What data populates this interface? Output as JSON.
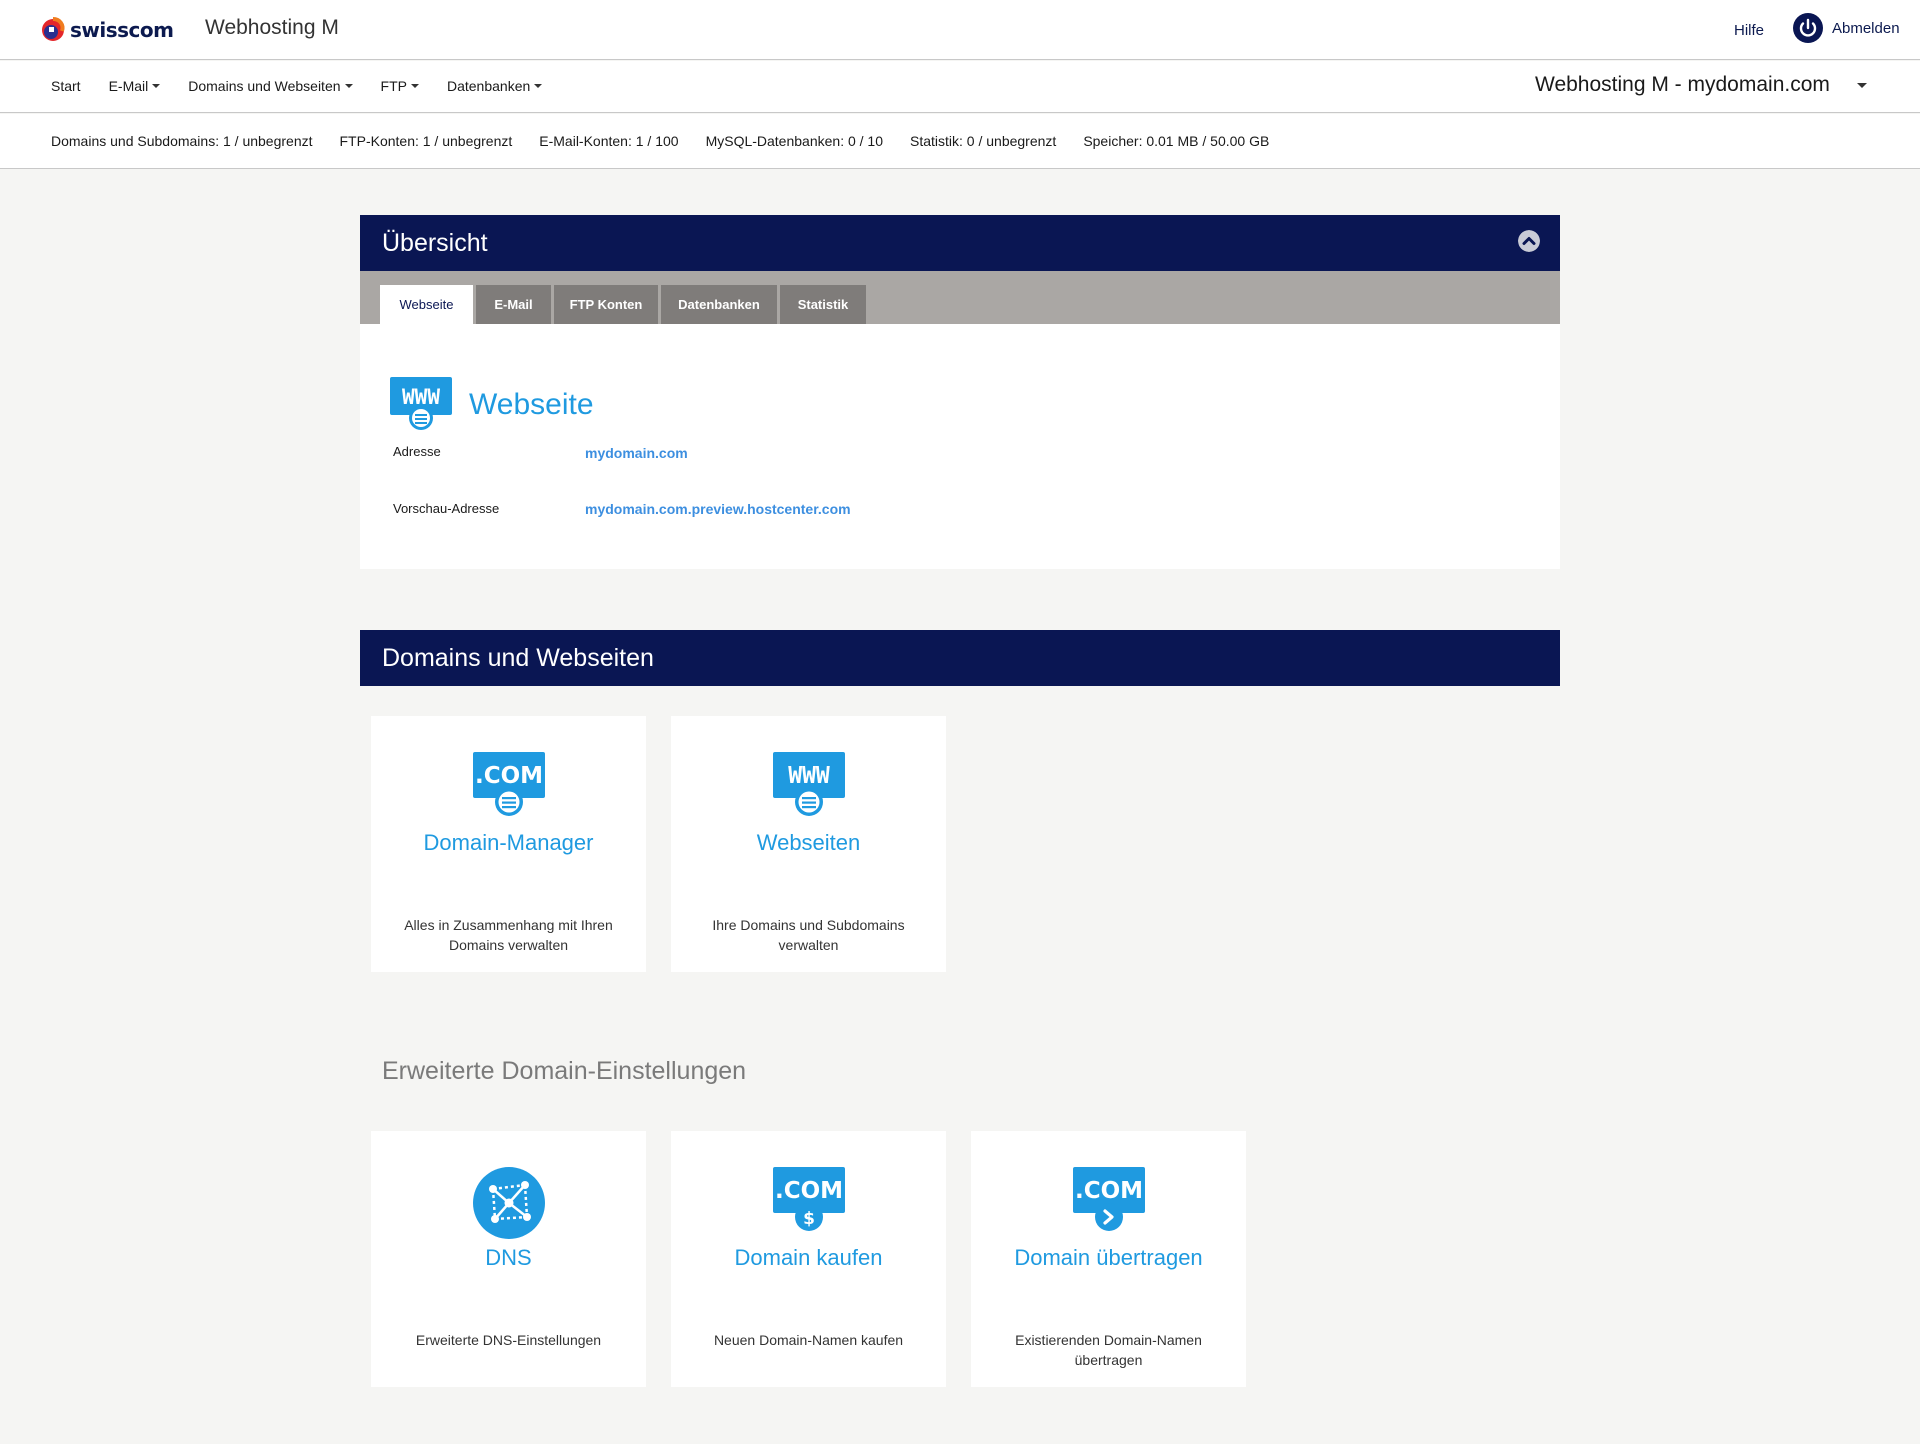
{
  "header": {
    "brand": "swisscom",
    "product": "Webhosting M",
    "help": "Hilfe",
    "logout": "Abmelden",
    "brand_color": "#0a1653",
    "accent_color": "#1f9ae0"
  },
  "nav": {
    "items": [
      {
        "label": "Start",
        "dropdown": false
      },
      {
        "label": "E-Mail",
        "dropdown": true
      },
      {
        "label": "Domains und Webseiten",
        "dropdown": true
      },
      {
        "label": "FTP",
        "dropdown": true
      },
      {
        "label": "Datenbanken",
        "dropdown": true
      }
    ],
    "account": "Webhosting M - mydomain.com"
  },
  "quotas": [
    "Domains und Subdomains: 1 / unbegrenzt",
    "FTP-Konten: 1 / unbegrenzt",
    "E-Mail-Konten: 1 / 100",
    "MySQL-Datenbanken: 0 / 10",
    "Statistik: 0 / unbegrenzt",
    "Speicher: 0.01 MB / 50.00 GB"
  ],
  "overview": {
    "title": "Übersicht",
    "tabs": [
      "Webseite",
      "E-Mail",
      "FTP Konten",
      "Datenbanken",
      "Statistik"
    ],
    "active_tab": "Webseite",
    "heading": "Webseite",
    "icon_text": "WWW",
    "rows": [
      {
        "label": "Adresse",
        "value": "mydomain.com"
      },
      {
        "label": "Vorschau-Adresse",
        "value": "mydomain.com.preview.hostcenter.com"
      }
    ]
  },
  "domains": {
    "title": "Domains und Webseiten",
    "cards": [
      {
        "icon": "dotcom-monitor-icon",
        "icon_text": ".COM",
        "title": "Domain-Manager",
        "desc": "Alles in Zusammenhang mit Ihren Domains verwalten"
      },
      {
        "icon": "www-monitor-icon",
        "icon_text": "WWW",
        "title": "Webseiten",
        "desc": "Ihre Domains und Subdomains verwalten"
      }
    ]
  },
  "advanced": {
    "title": "Erweiterte Domain-Einstellungen",
    "cards": [
      {
        "icon": "dns-network-icon",
        "title": "DNS",
        "desc": "Erweiterte DNS-Einstellungen"
      },
      {
        "icon": "dotcom-buy-icon",
        "icon_text": ".COM",
        "title": "Domain kaufen",
        "desc": "Neuen Domain-Namen kaufen"
      },
      {
        "icon": "dotcom-transfer-icon",
        "icon_text": ".COM",
        "title": "Domain übertragen",
        "desc": "Existierenden Domain-Namen übertragen"
      }
    ]
  }
}
